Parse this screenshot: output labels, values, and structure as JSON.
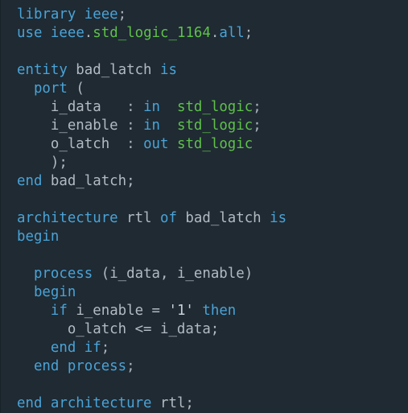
{
  "colors": {
    "background": "#1f2a33",
    "keyword": "#4aa3d6",
    "type": "#5fc14a",
    "text": "#b2bac2"
  },
  "code": [
    [
      [
        "kw",
        "library ieee"
      ],
      [
        "pn",
        ";"
      ]
    ],
    [
      [
        "kw",
        "use"
      ],
      [
        "tx",
        " "
      ],
      [
        "kw",
        "ieee"
      ],
      [
        "pn",
        "."
      ],
      [
        "ty",
        "std_logic_1164"
      ],
      [
        "pn",
        "."
      ],
      [
        "kw",
        "all"
      ],
      [
        "pn",
        ";"
      ]
    ],
    [],
    [
      [
        "kw",
        "entity"
      ],
      [
        "tx",
        " bad_latch "
      ],
      [
        "kw",
        "is"
      ]
    ],
    [
      [
        "tx",
        "  "
      ],
      [
        "kw",
        "port"
      ],
      [
        "tx",
        " ("
      ]
    ],
    [
      [
        "tx",
        "    i_data   "
      ],
      [
        "pn",
        ": "
      ],
      [
        "kw",
        "in"
      ],
      [
        "tx",
        "  "
      ],
      [
        "ty",
        "std_logic"
      ],
      [
        "pn",
        ";"
      ]
    ],
    [
      [
        "tx",
        "    i_enable "
      ],
      [
        "pn",
        ": "
      ],
      [
        "kw",
        "in"
      ],
      [
        "tx",
        "  "
      ],
      [
        "ty",
        "std_logic"
      ],
      [
        "pn",
        ";"
      ]
    ],
    [
      [
        "tx",
        "    o_latch  "
      ],
      [
        "pn",
        ": "
      ],
      [
        "kw",
        "out"
      ],
      [
        "tx",
        " "
      ],
      [
        "ty",
        "std_logic"
      ]
    ],
    [
      [
        "tx",
        "    );"
      ]
    ],
    [
      [
        "kw",
        "end"
      ],
      [
        "tx",
        " bad_latch;"
      ]
    ],
    [],
    [
      [
        "kw",
        "architecture"
      ],
      [
        "tx",
        " rtl "
      ],
      [
        "kw",
        "of"
      ],
      [
        "tx",
        " bad_latch "
      ],
      [
        "kw",
        "is"
      ]
    ],
    [
      [
        "kw",
        "begin"
      ]
    ],
    [],
    [
      [
        "tx",
        "  "
      ],
      [
        "kw",
        "process"
      ],
      [
        "tx",
        " (i_data, i_enable)"
      ]
    ],
    [
      [
        "tx",
        "  "
      ],
      [
        "kw",
        "begin"
      ]
    ],
    [
      [
        "tx",
        "    "
      ],
      [
        "kw",
        "if"
      ],
      [
        "tx",
        " i_enable = "
      ],
      [
        "st",
        "'1'"
      ],
      [
        "tx",
        " "
      ],
      [
        "kw",
        "then"
      ]
    ],
    [
      [
        "tx",
        "      o_latch <= i_data;"
      ]
    ],
    [
      [
        "tx",
        "    "
      ],
      [
        "kw",
        "end if"
      ],
      [
        "pn",
        ";"
      ]
    ],
    [
      [
        "tx",
        "  "
      ],
      [
        "kw",
        "end process"
      ],
      [
        "pn",
        ";"
      ]
    ],
    [],
    [
      [
        "kw",
        "end architecture"
      ],
      [
        "tx",
        " rtl;"
      ]
    ]
  ]
}
